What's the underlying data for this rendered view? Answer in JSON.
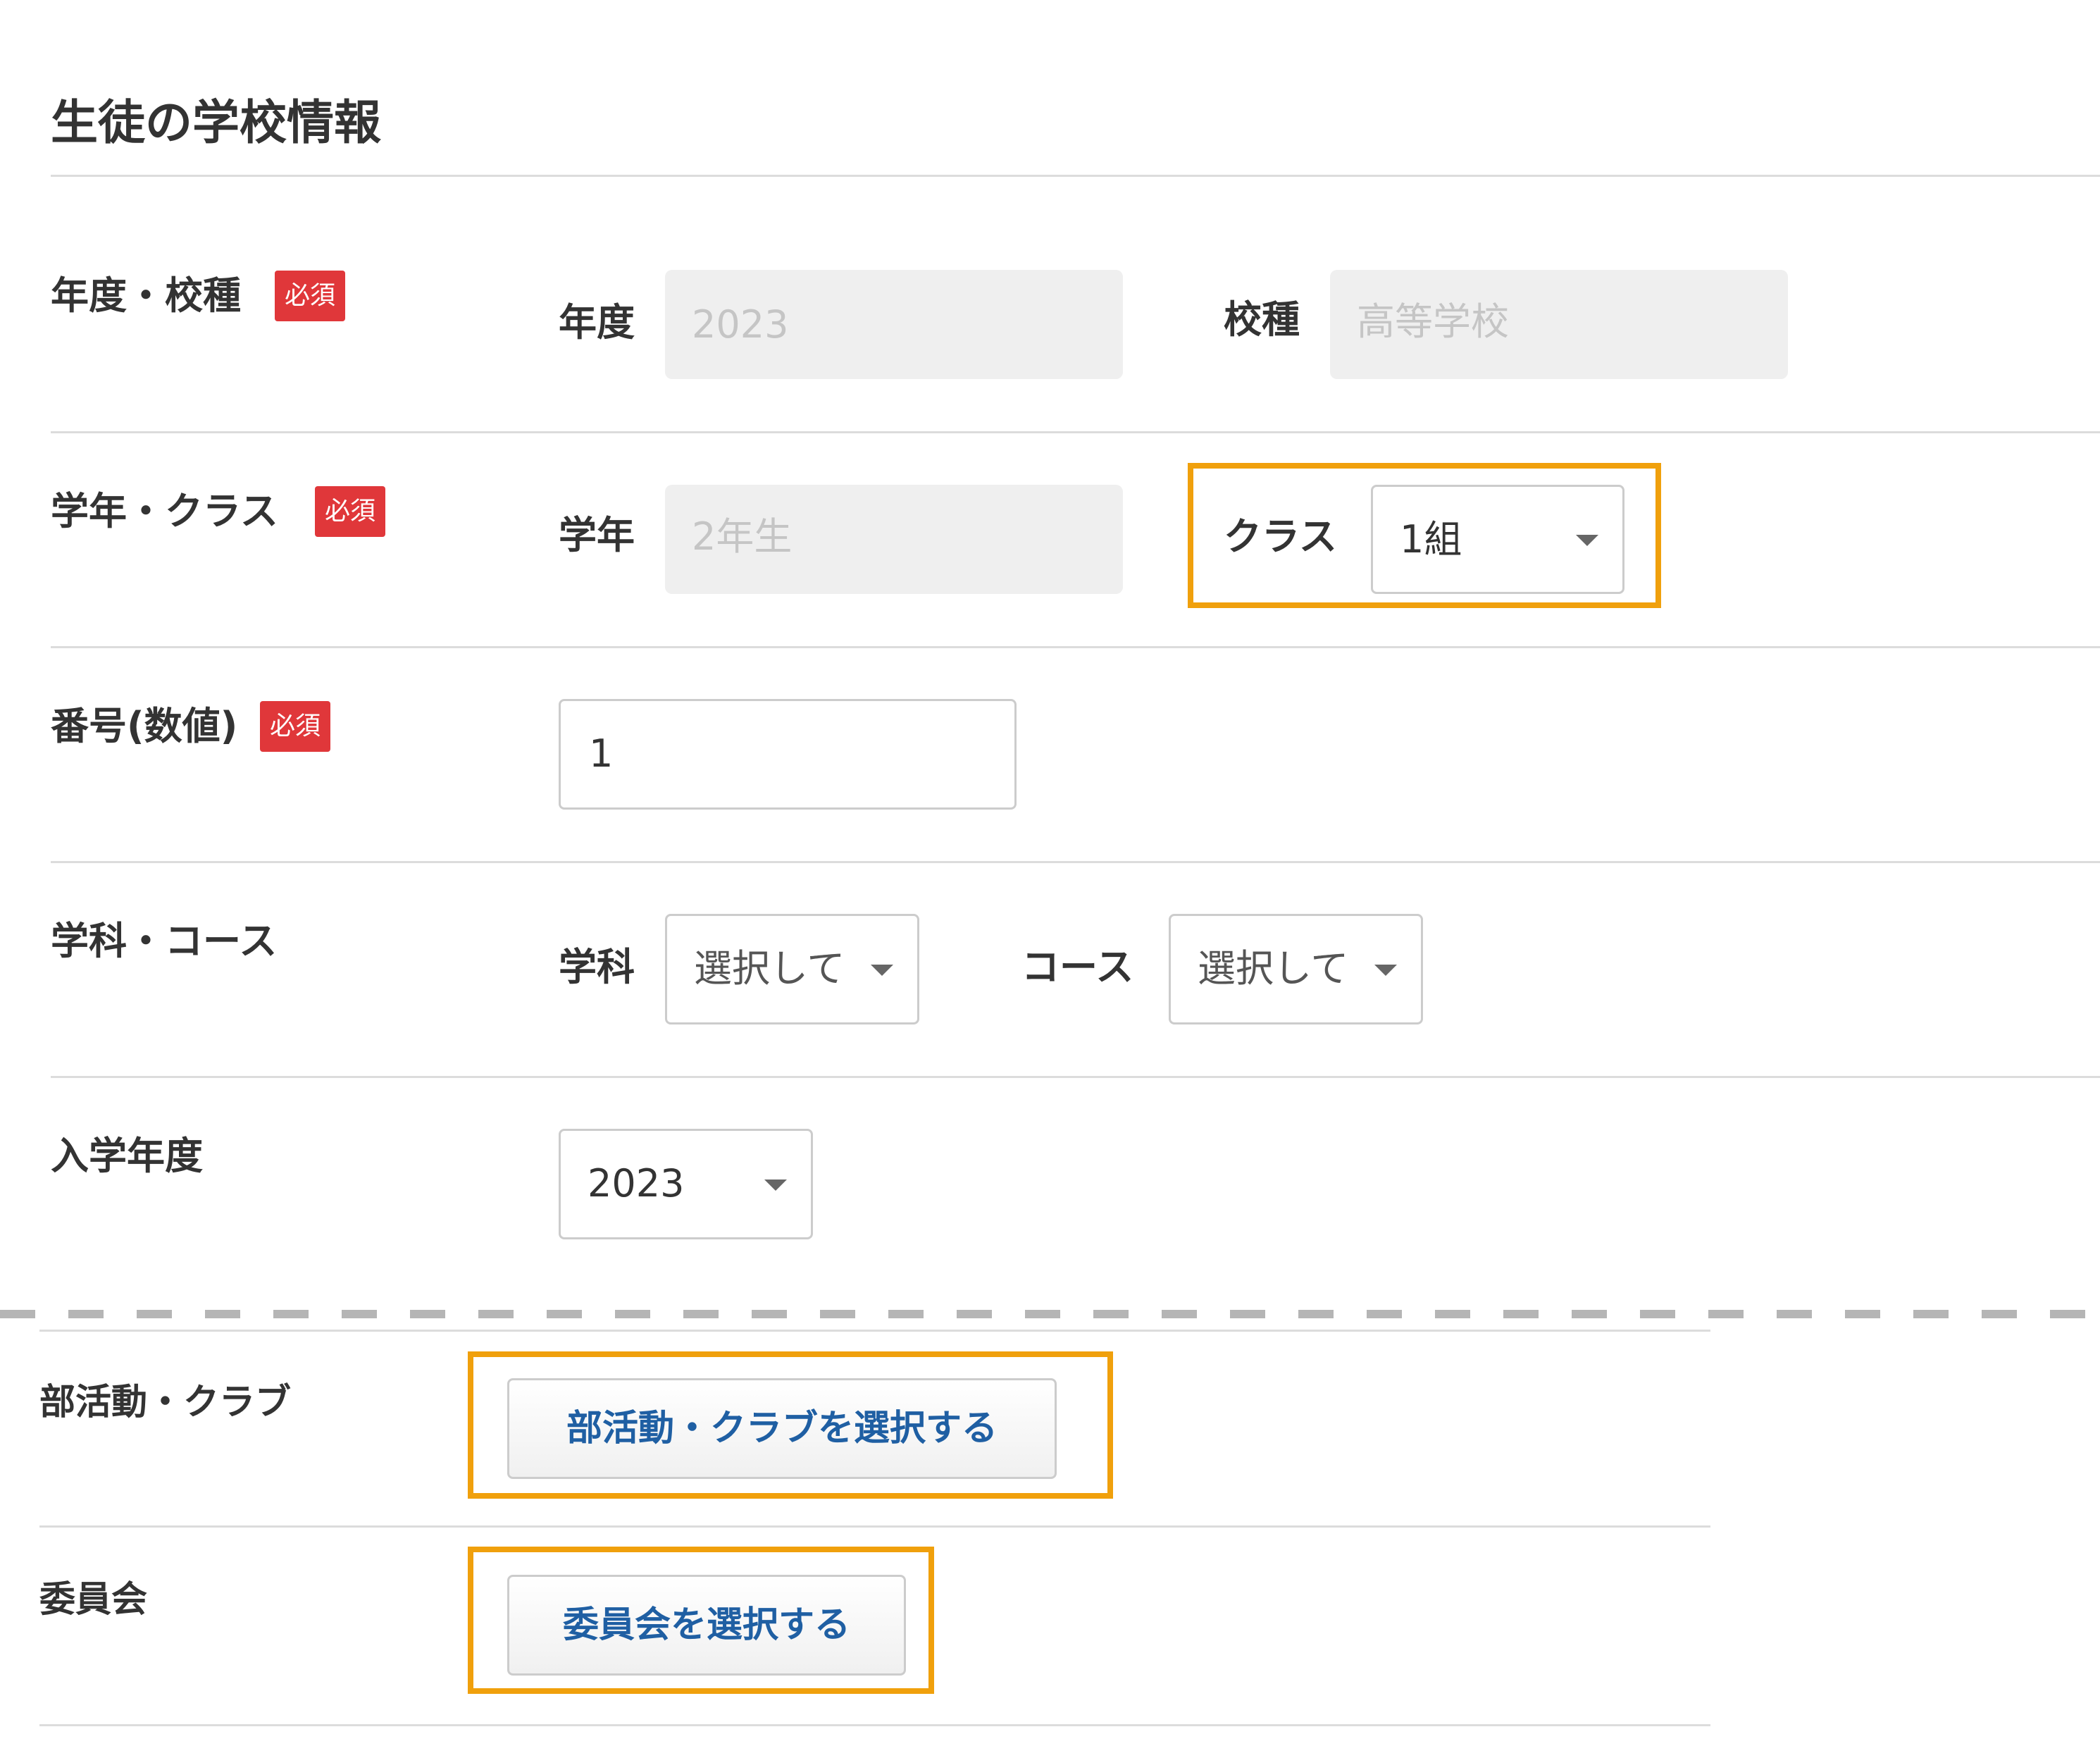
{
  "section": {
    "title": "生徒の学校情報"
  },
  "required_badge": "必須",
  "rows": {
    "year_type": {
      "label": "年度・校種",
      "year_label": "年度",
      "year_value": "2023",
      "type_label": "校種",
      "type_value": "高等学校"
    },
    "grade_class": {
      "label": "学年・クラス",
      "grade_label": "学年",
      "grade_value": "2年生",
      "class_label": "クラス",
      "class_value": "1組"
    },
    "number": {
      "label": "番号(数値)",
      "value": "1"
    },
    "dept_course": {
      "label": "学科・コース",
      "dept_label": "学科",
      "dept_value": "選択して",
      "course_label": "コース",
      "course_value": "選択して"
    },
    "admission_year": {
      "label": "入学年度",
      "value": "2023"
    },
    "club": {
      "label": "部活動・クラブ",
      "button": "部活動・クラブを選択する"
    },
    "committee": {
      "label": "委員会",
      "button": "委員会を選択する"
    }
  },
  "colors": {
    "highlight": "#f0a00c",
    "required_badge": "#e0373a",
    "button_text": "#1f5fa3",
    "readonly_bg": "#efefef"
  },
  "icons": [
    "chevron-down-icon"
  ]
}
